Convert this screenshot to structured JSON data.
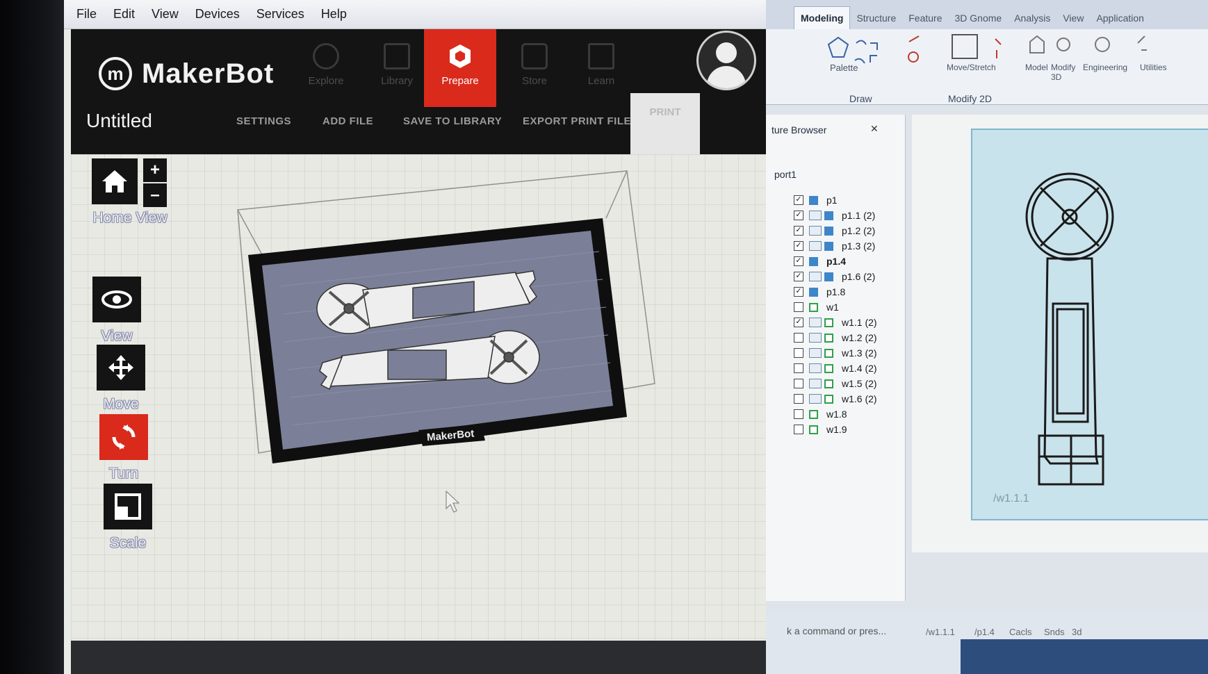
{
  "makerbot": {
    "menu": [
      "File",
      "Edit",
      "View",
      "Devices",
      "Services",
      "Help"
    ],
    "logo_text": "MakerBot",
    "tabs": [
      {
        "label": "Explore",
        "active": false
      },
      {
        "label": "Library",
        "active": false
      },
      {
        "label": "Prepare",
        "active": true
      },
      {
        "label": "Store",
        "active": false
      },
      {
        "label": "Learn",
        "active": false
      }
    ],
    "title": "Untitled",
    "actions": {
      "settings": "SETTINGS",
      "add_file": "ADD FILE",
      "save_to_library": "SAVE TO LIBRARY",
      "export_print_file": "EXPORT PRINT FILE",
      "print": "PRINT"
    },
    "tools": {
      "home_view": "Home View",
      "zoom_in": "+",
      "zoom_out": "–",
      "view": "View",
      "move": "Move",
      "turn": "Turn",
      "scale": "Scale"
    },
    "plate_label": "MakerBot",
    "colors": {
      "accent": "#d92a1c",
      "header": "#141414",
      "plate": "#7b8098"
    }
  },
  "cad": {
    "ribbon_tabs": [
      "Modeling",
      "Structure",
      "Feature",
      "3D Gnome",
      "Analysis",
      "View",
      "Application"
    ],
    "active_tab": "Modeling",
    "ribbon_labels": {
      "palette": "Palette",
      "move_stretch": "Move/Stretch",
      "model": "Model",
      "modify3d": "Modify 3D",
      "engineering": "Engineering",
      "utilities": "Utilities"
    },
    "panel_titles": {
      "draw": "Draw",
      "modify2d": "Modify 2D"
    },
    "browser_title": "ture Browser",
    "viewport_name": "port1",
    "layers": [
      {
        "name": "p1",
        "checked": true,
        "group": false,
        "swatch": "blue",
        "bold": false
      },
      {
        "name": "p1.1 (2)",
        "checked": true,
        "group": true,
        "swatch": "blue",
        "bold": false
      },
      {
        "name": "p1.2 (2)",
        "checked": true,
        "group": true,
        "swatch": "blue",
        "bold": false
      },
      {
        "name": "p1.3 (2)",
        "checked": true,
        "group": true,
        "swatch": "blue",
        "bold": false
      },
      {
        "name": "p1.4",
        "checked": true,
        "group": false,
        "swatch": "blue",
        "bold": true
      },
      {
        "name": "p1.6 (2)",
        "checked": true,
        "group": true,
        "swatch": "blue",
        "bold": false
      },
      {
        "name": "p1.8",
        "checked": true,
        "group": false,
        "swatch": "blue",
        "bold": false
      },
      {
        "name": "w1",
        "checked": false,
        "group": false,
        "swatch": "green",
        "bold": false
      },
      {
        "name": "w1.1 (2)",
        "checked": true,
        "group": true,
        "swatch": "green",
        "bold": false
      },
      {
        "name": "w1.2 (2)",
        "checked": false,
        "group": true,
        "swatch": "green",
        "bold": false
      },
      {
        "name": "w1.3 (2)",
        "checked": false,
        "group": true,
        "swatch": "green",
        "bold": false
      },
      {
        "name": "w1.4 (2)",
        "checked": false,
        "group": true,
        "swatch": "green",
        "bold": false
      },
      {
        "name": "w1.5 (2)",
        "checked": false,
        "group": true,
        "swatch": "green",
        "bold": false
      },
      {
        "name": "w1.6 (2)",
        "checked": false,
        "group": true,
        "swatch": "green",
        "bold": false
      },
      {
        "name": "w1.8",
        "checked": false,
        "group": false,
        "swatch": "green",
        "bold": false
      },
      {
        "name": "w1.9",
        "checked": false,
        "group": false,
        "swatch": "green",
        "bold": false
      }
    ],
    "sheet_label": "/w1.1.1",
    "command_prompt": "k a command or pres...",
    "status_items": [
      "/w1.1.1",
      "/p1.4",
      "Cacls",
      "Snds",
      "3d"
    ]
  }
}
